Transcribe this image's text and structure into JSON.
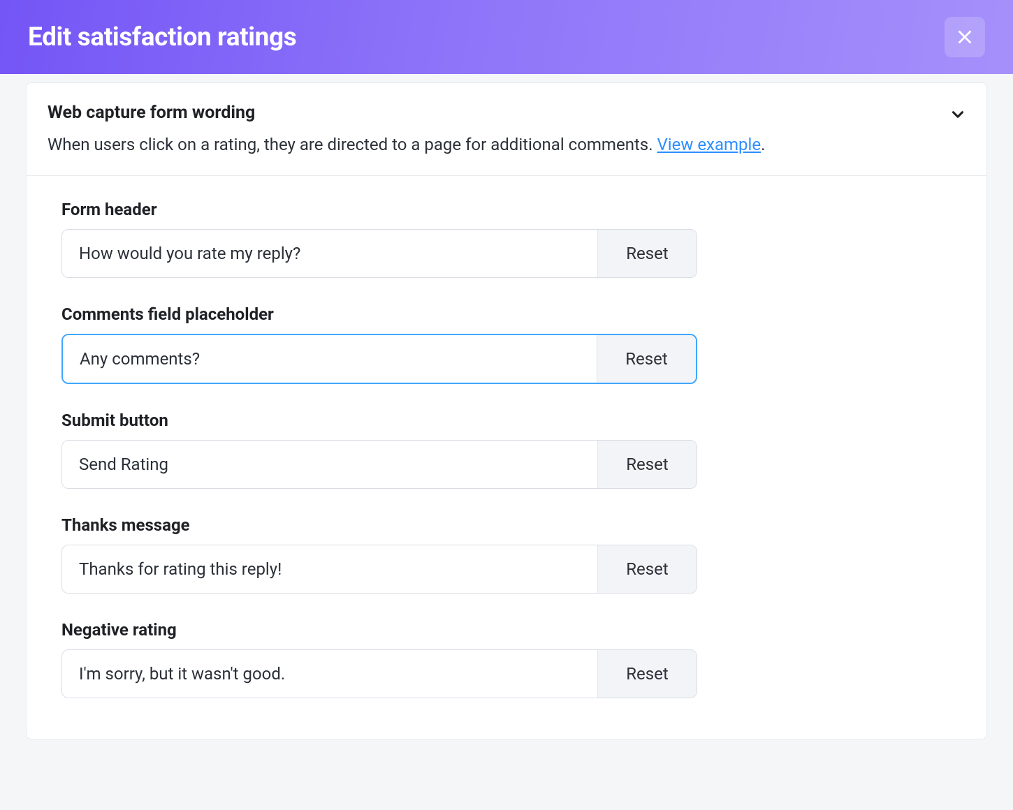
{
  "header": {
    "title": "Edit satisfaction ratings"
  },
  "section": {
    "title": "Web capture form wording",
    "description_prefix": "When users click on a rating, they are directed to a page for additional comments. ",
    "view_example_label": "View example",
    "description_suffix": "."
  },
  "fields": [
    {
      "label": "Form header",
      "value": "How would you rate my reply?",
      "reset_label": "Reset",
      "focused": false
    },
    {
      "label": "Comments field placeholder",
      "value": "Any comments?",
      "reset_label": "Reset",
      "focused": true
    },
    {
      "label": "Submit button",
      "value": "Send Rating",
      "reset_label": "Reset",
      "focused": false
    },
    {
      "label": "Thanks message",
      "value": "Thanks for rating this reply!",
      "reset_label": "Reset",
      "focused": false
    },
    {
      "label": "Negative rating",
      "value": "I'm sorry, but it wasn't good.",
      "reset_label": "Reset",
      "focused": false
    }
  ]
}
